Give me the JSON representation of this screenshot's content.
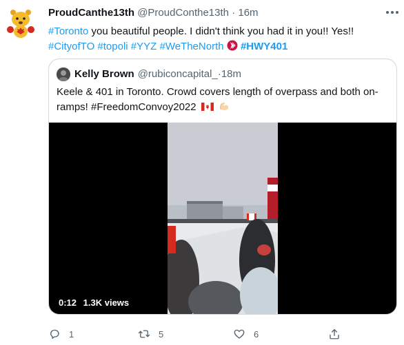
{
  "tweet": {
    "display_name": "ProudCanthe13th",
    "handle": "@ProudConthe13th",
    "separator": "·",
    "time": "16m",
    "text_before": "you beautiful people. I didn't think you had it in you!!  Yes!!",
    "hashtags": {
      "toronto": "#Toronto",
      "cityofto": "#CityofTO",
      "topoli": "#topoli",
      "yyz": "#YYZ",
      "wethenorth": "#WeTheNorth",
      "hwy401": "#HWY401"
    }
  },
  "quote": {
    "display_name": "Kelly Brown",
    "handle": "@rubiconcapital_",
    "separator": "·",
    "time": "18m",
    "text": "Keele & 401 in Toronto. Crowd covers length of overpass and both on-ramps! #FreedomConvoy2022",
    "video": {
      "duration": "0:12",
      "views": "1.3K views"
    }
  },
  "actions": {
    "reply_count": "1",
    "retweet_count": "5",
    "like_count": "6"
  },
  "icons": {
    "reply": "reply-icon",
    "retweet": "retweet-icon",
    "like": "heart-icon",
    "share": "share-icon",
    "more": "more-icon"
  },
  "colors": {
    "link": "#1d9bf0",
    "text": "#0f1419",
    "muted": "#536471",
    "border": "#cfd9de"
  }
}
